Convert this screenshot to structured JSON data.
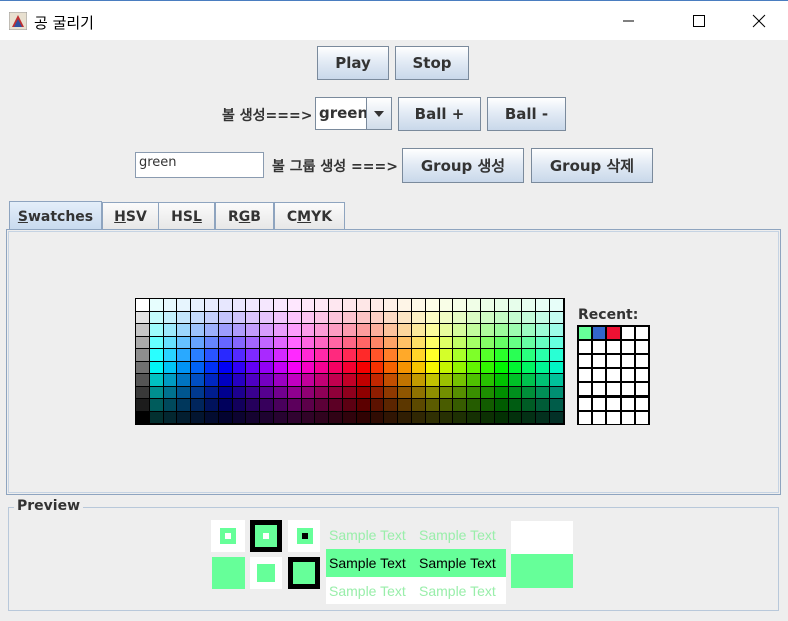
{
  "window": {
    "title": "공 굴리기",
    "minimize_icon": "minimize-icon",
    "maximize_icon": "maximize-icon",
    "close_icon": "close-icon"
  },
  "toolbar": {
    "play_label": "Play",
    "stop_label": "Stop"
  },
  "ball_row": {
    "label": "볼 생성===>",
    "color_select_value": "green",
    "ball_add_label": "Ball +",
    "ball_remove_label": "Ball -"
  },
  "group_row": {
    "input_value": "green",
    "label": "볼 그룹 생성 ===>",
    "group_create_label": "Group 생성",
    "group_delete_label": "Group 삭제"
  },
  "tabs": [
    {
      "pre": "",
      "mn": "S",
      "post": "watches",
      "active": true
    },
    {
      "pre": "",
      "mn": "H",
      "post": "SV",
      "active": false
    },
    {
      "pre": "HS",
      "mn": "L",
      "post": "",
      "active": false
    },
    {
      "pre": "R",
      "mn": "G",
      "post": "B",
      "active": false
    },
    {
      "pre": "C",
      "mn": "M",
      "post": "YK",
      "active": false
    }
  ],
  "recent": {
    "label": "Recent:",
    "colors": [
      "#66ff99",
      "#3366cc",
      "#ee1133"
    ]
  },
  "preview": {
    "label": "Preview",
    "sample_text": "Sample Text",
    "color": "#66ff99"
  }
}
